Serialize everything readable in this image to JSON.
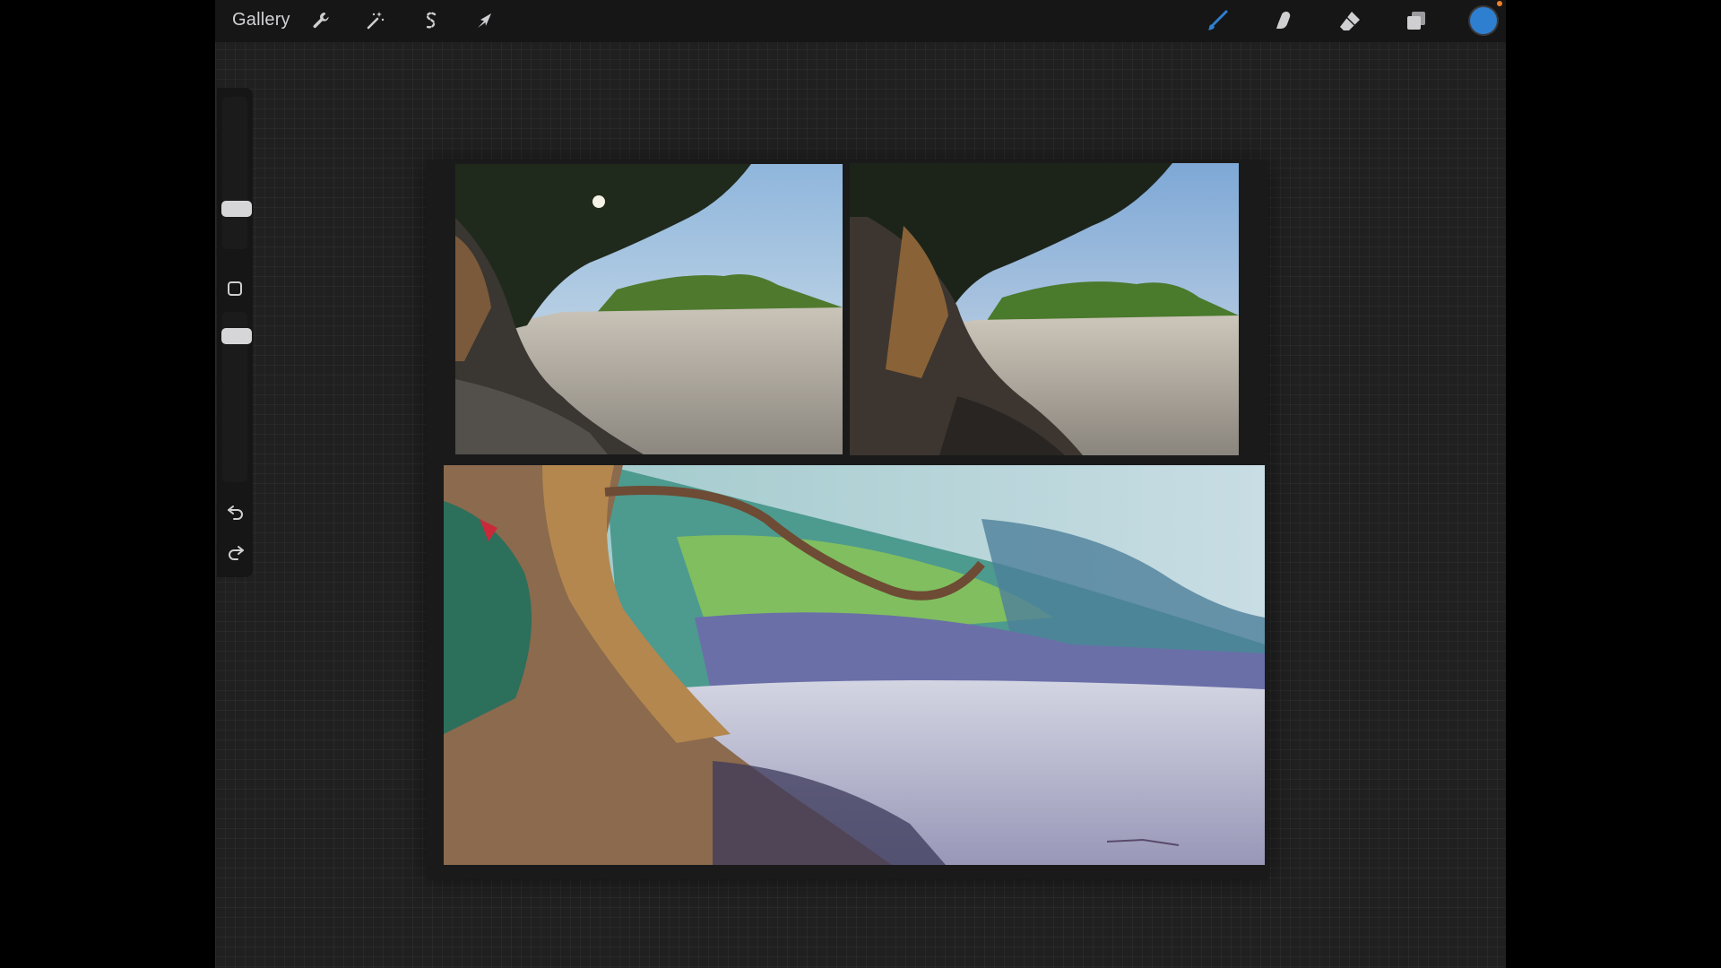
{
  "topbar": {
    "gallery_label": "Gallery",
    "tools": [
      {
        "name": "actions",
        "icon": "wrench-icon"
      },
      {
        "name": "adjustments",
        "icon": "magic-wand-icon"
      },
      {
        "name": "selection",
        "icon": "selection-s-icon"
      },
      {
        "name": "transform",
        "icon": "arrow-cursor-icon"
      }
    ],
    "right_tools": [
      {
        "name": "brush",
        "icon": "brush-icon"
      },
      {
        "name": "smudge",
        "icon": "smudge-finger-icon"
      },
      {
        "name": "eraser",
        "icon": "eraser-icon"
      },
      {
        "name": "layers",
        "icon": "layers-icon"
      }
    ],
    "current_color": "#2f7fd0"
  },
  "sidebar": {
    "brush_size_icon": "slider-thumb",
    "modify_button_icon": "square-icon",
    "opacity_icon": "slider-thumb",
    "undo_icon": "undo-icon",
    "redo_icon": "redo-icon"
  },
  "canvas": {
    "panels": [
      {
        "name": "reference-photo-1",
        "description_icon": "photo"
      },
      {
        "name": "reference-photo-2",
        "description_icon": "photo"
      },
      {
        "name": "painting",
        "description_icon": "painting"
      }
    ]
  },
  "colors": {
    "app_background": "#202021",
    "topbar": "#161617",
    "accent_blue": "#2f7fd0",
    "notification": "#f2802a"
  }
}
